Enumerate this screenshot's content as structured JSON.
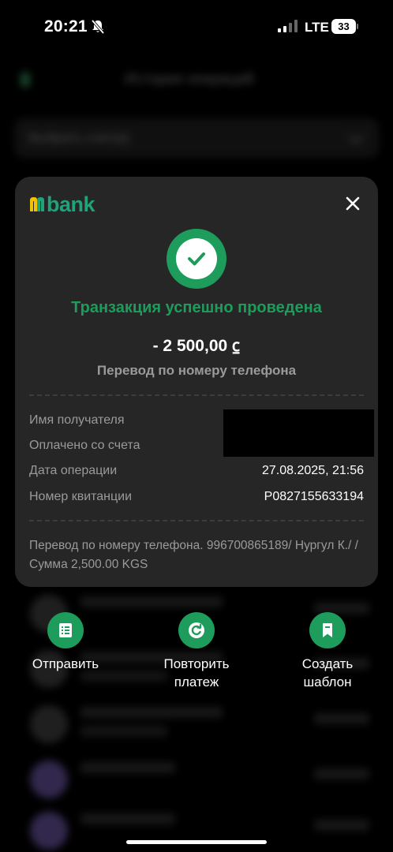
{
  "status_bar": {
    "time": "20:21",
    "network": "LTE",
    "battery": "33"
  },
  "background": {
    "title": "История операций",
    "filter_label": "Выбрать счет(а)"
  },
  "receipt": {
    "brand": "bank",
    "status_title": "Транзакция успешно проведена",
    "amount": "- 2 500,00 ⃀",
    "operation_type": "Перевод по номеру телефона",
    "details": [
      {
        "label": "Имя получателя",
        "value": ""
      },
      {
        "label": "Оплачено со счета",
        "value": ""
      },
      {
        "label": "Дата операции",
        "value": "27.08.2025, 21:56"
      },
      {
        "label": "Номер квитанции",
        "value": "P0827155633194"
      }
    ],
    "comment": "Перевод по номеру телефона. 996700865189/ Нургул К./  / Сумма 2,500.00 KGS"
  },
  "actions": {
    "send_label": "Отправить",
    "repeat_label": "Повторить платеж",
    "template_label": "Создать шаблон"
  },
  "colors": {
    "accent": "#1d9c5b",
    "brand": "#1ea37b",
    "card": "#262626"
  }
}
